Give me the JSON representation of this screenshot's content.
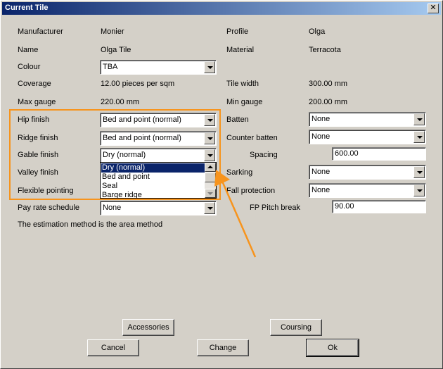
{
  "window": {
    "title": "Current Tile",
    "close": "✕"
  },
  "fields": {
    "manufacturer": {
      "label": "Manufacturer",
      "value": "Monier"
    },
    "profile": {
      "label": "Profile",
      "value": "Olga"
    },
    "name": {
      "label": "Name",
      "value": "Olga Tile"
    },
    "material": {
      "label": "Material",
      "value": "Terracota"
    },
    "colour": {
      "label": "Colour",
      "value": "TBA"
    },
    "coverage": {
      "label": "Coverage",
      "value": "12.00 pieces per sqm"
    },
    "tile_width": {
      "label": "Tile width",
      "value": "300.00 mm"
    },
    "max_gauge": {
      "label": "Max gauge",
      "value": "220.00 mm"
    },
    "min_gauge": {
      "label": "Min gauge",
      "value": "200.00 mm"
    },
    "hip_finish": {
      "label": "Hip finish",
      "value": "Bed and point (normal)"
    },
    "batten": {
      "label": "Batten",
      "value": "None"
    },
    "ridge_finish": {
      "label": "Ridge finish",
      "value": "Bed and point (normal)"
    },
    "counter_batten": {
      "label": "Counter batten",
      "value": "None"
    },
    "gable_finish": {
      "label": "Gable finish",
      "value": "Dry (normal)"
    },
    "spacing": {
      "label": "Spacing",
      "value": "600.00"
    },
    "valley_finish": {
      "label": "Valley  finish"
    },
    "sarking": {
      "label": "Sarking",
      "value": "None"
    },
    "flexible_pointing": {
      "label": "Flexible pointing"
    },
    "fall_protection": {
      "label": "Fall protection",
      "value": "None"
    },
    "pay_rate_schedule": {
      "label": "Pay rate schedule",
      "value": "None"
    },
    "fp_pitch_break": {
      "label": "FP Pitch break",
      "value": "90.00"
    }
  },
  "note": "The estimation method is the area method",
  "gable_dropdown": {
    "options": [
      "Dry (normal)",
      "Bed and point",
      "Seal",
      "Barge  ridge"
    ],
    "selected_index": 0
  },
  "buttons": {
    "accessories": "Accessories",
    "coursing": "Coursing",
    "cancel": "Cancel",
    "change": "Change",
    "ok": "Ok"
  },
  "colors": {
    "annotation": "#f7941d",
    "titlebar": "#0a246a",
    "selection": "#0a246a"
  }
}
